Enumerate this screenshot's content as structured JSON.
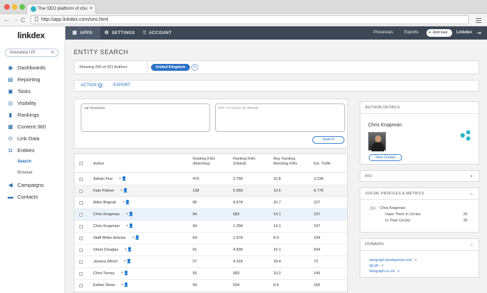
{
  "browser": {
    "tab_title": "The SEO platform of cho",
    "tab_close": "×",
    "url": "http://app.linkdex.com/seo.html",
    "back_icon": "←",
    "forward_icon": "→",
    "reload_icon": "C"
  },
  "sidebar": {
    "logo": "linkdex",
    "site_selector": "Insurance US",
    "items": [
      {
        "label": "Dashboards",
        "icon": "dashboard-icon",
        "glyph": "◉"
      },
      {
        "label": "Reporting",
        "icon": "report-icon",
        "glyph": "▤"
      },
      {
        "label": "Tasks",
        "icon": "tasks-icon",
        "glyph": "▣"
      },
      {
        "label": "Visibility",
        "icon": "eye-icon",
        "glyph": "◎"
      },
      {
        "label": "Rankings",
        "icon": "bar-chart-icon",
        "glyph": "▮"
      },
      {
        "label": "Content 360",
        "icon": "content-icon",
        "glyph": "▦"
      },
      {
        "label": "Link Data",
        "icon": "link-icon",
        "glyph": "⊙"
      },
      {
        "label": "Entities",
        "icon": "entities-icon",
        "glyph": "◘"
      },
      {
        "label": "Campaigns",
        "icon": "megaphone-icon",
        "glyph": "◀"
      },
      {
        "label": "Contacts",
        "icon": "contacts-icon",
        "glyph": "▬"
      }
    ],
    "sub_items": [
      "Search",
      "Browser"
    ]
  },
  "topbar": {
    "apps": "APPS",
    "settings": "SETTINGS",
    "account": "ACCOUNT",
    "processes": "Processes",
    "exports": "Exports",
    "add_task": "Add task",
    "brand": "Linkdex"
  },
  "page": {
    "title": "ENTITY SEARCH",
    "showing": "Showing 250 of 321 Authors",
    "filter_pill": "United Kingdom",
    "filter_add": "+",
    "action": "ACTION",
    "export": "EXPORT"
  },
  "search": {
    "query_value": "car insurance",
    "domain_placeholder": "find / or search by domain",
    "button": "Search"
  },
  "table": {
    "headers": {
      "author": "Author",
      "ranking_matching": "Ranking KWs (Matching)",
      "ranking_global": "Ranking KWs (Global)",
      "avg_ranking": "Avg. Ranking Matching KWs",
      "traffic": "Est. Traffic"
    },
    "rows": [
      {
        "author": "Adrian Flux",
        "matching": "470",
        "global": "2.75K",
        "avg": "15.8",
        "traffic": "3.23K"
      },
      {
        "author": "Kate Palmer",
        "matching": "138",
        "global": "5.65K",
        "avg": "19.6",
        "traffic": "6.77K"
      },
      {
        "author": "Miles Brignall",
        "matching": "85",
        "global": "8.47K",
        "avg": "15.7",
        "traffic": "227"
      },
      {
        "author": "Chris Knapman",
        "matching": "84",
        "global": "583",
        "avg": "14.1",
        "traffic": "197"
      },
      {
        "author": "Chris Knapman",
        "matching": "84",
        "global": "1.25K",
        "avg": "14.1",
        "traffic": "197"
      },
      {
        "author": "Staff Writer Articles",
        "matching": "64",
        "global": "1.57K",
        "avg": "8.0",
        "traffic": "194"
      },
      {
        "author": "Shem Douglas",
        "matching": "61",
        "global": "4.83K",
        "avg": "16.1",
        "traffic": "504"
      },
      {
        "author": "Jessica Winch",
        "matching": "57",
        "global": "4.31K",
        "avg": "18.4",
        "traffic": "73"
      },
      {
        "author": "Chris Torney",
        "matching": "55",
        "global": "583",
        "avg": "10.2",
        "traffic": "145"
      },
      {
        "author": "Esther Show",
        "matching": "54",
        "global": "634",
        "avg": "8.4",
        "traffic": "156"
      }
    ]
  },
  "author_details": {
    "header": "AUTHOR DETAILS",
    "name": "Chris Knapman",
    "view_contact": "View Contact"
  },
  "panel_bio": {
    "header": "BIO",
    "toggle": "+"
  },
  "social": {
    "header": "SOCIAL PROFILES & METRICS",
    "toggle": "–",
    "network_glyph": "G+",
    "name": "Chris Knapman",
    "have_label": "Have Them in Circles",
    "have_value": "26",
    "in_label": "In Their Circles",
    "in_value": "35"
  },
  "domains": {
    "header": "DOMAINS",
    "toggle": "–",
    "items": [
      "telegraph.feedsportal.com",
      "tgr.ph",
      "telegraph.co.uk"
    ]
  },
  "colors": {
    "accent": "#2c72c6",
    "topbar": "#3d4756",
    "share": "#2bb5c8"
  }
}
